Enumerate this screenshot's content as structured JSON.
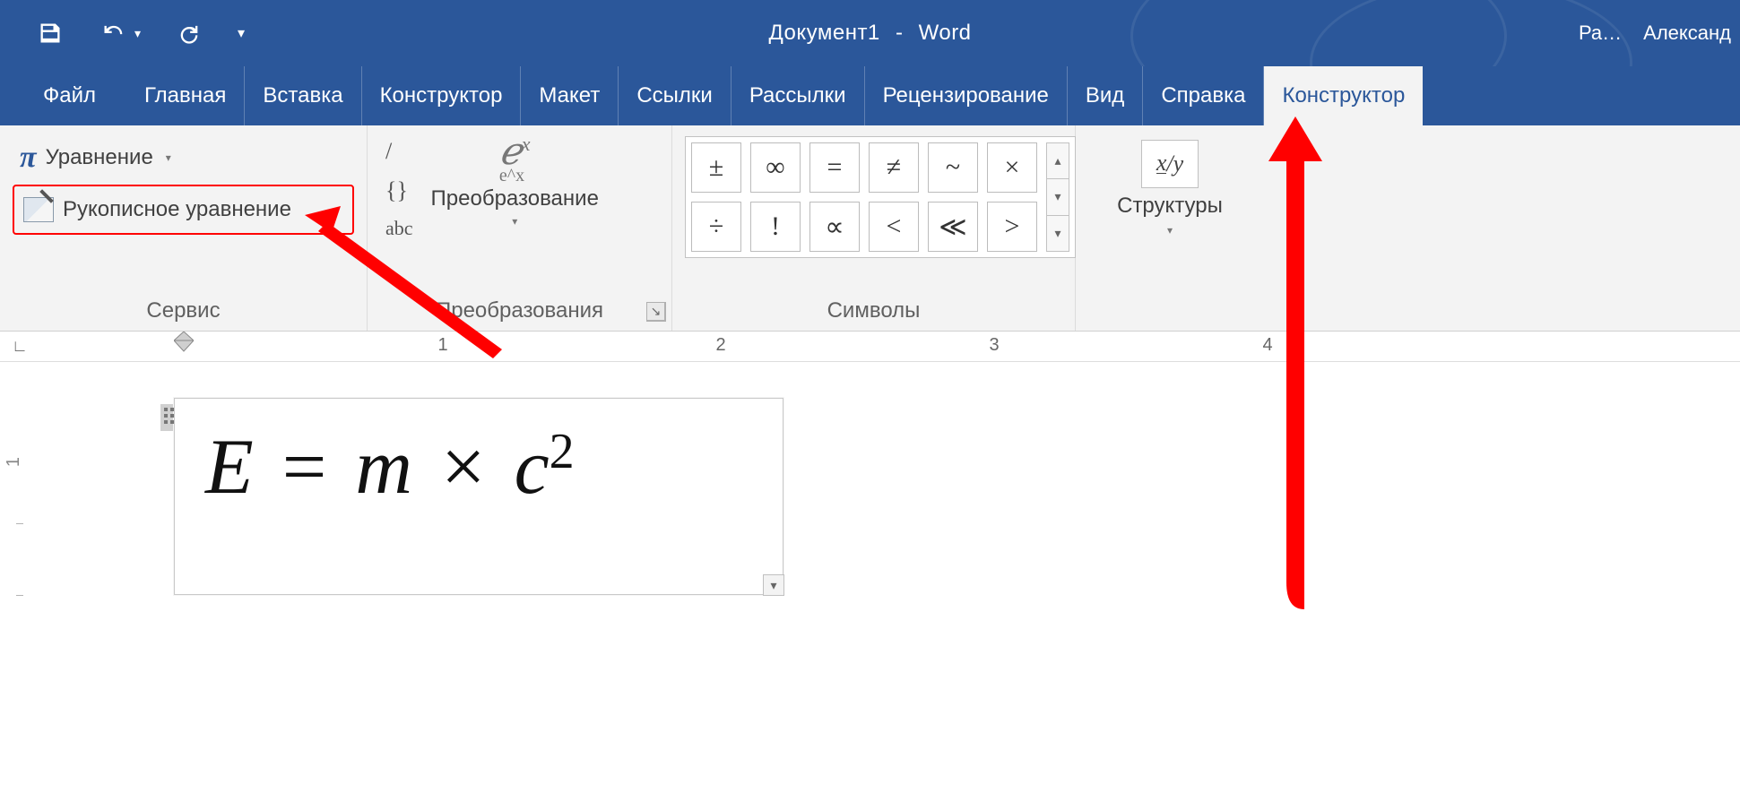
{
  "qat": {
    "save": "save",
    "undo": "undo",
    "redo": "redo",
    "customize": "customize"
  },
  "title": {
    "doc": "Документ1",
    "dash": "-",
    "app": "Word"
  },
  "title_right": {
    "truncated_tab": "Ра…",
    "user": "Александ"
  },
  "tabs": [
    "Файл",
    "Главная",
    "Вставка",
    "Конструктор",
    "Макет",
    "Ссылки",
    "Рассылки",
    "Рецензирование",
    "Вид",
    "Справка"
  ],
  "active_tab": "Конструктор",
  "ribbon": {
    "g1": {
      "equation_label": "Уравнение",
      "ink_label": "Рукописное уравнение",
      "group_label": "Сервис"
    },
    "g2": {
      "item_slash": "/",
      "item_braces": "{}",
      "item_abc": "abc",
      "convert_label": "Преобразование",
      "group_label": "Преобразования"
    },
    "g3": {
      "symbols": [
        "±",
        "∞",
        "=",
        "≠",
        "~",
        "×",
        "÷",
        "!",
        "∝",
        "<",
        "≪",
        ">"
      ],
      "group_label": "Символы"
    },
    "g4": {
      "struct_label": "Структуры",
      "fraction_icon_top": "x",
      "fraction_icon_bot": "y"
    }
  },
  "ruler": {
    "nums": [
      "1",
      "2",
      "3",
      "4"
    ]
  },
  "vruler": {
    "nums": [
      "1"
    ]
  },
  "equation": {
    "E": "E",
    "eq": "=",
    "m": "m",
    "times": "×",
    "c": "c",
    "sq": "2",
    "plain": "E = m × c²"
  }
}
